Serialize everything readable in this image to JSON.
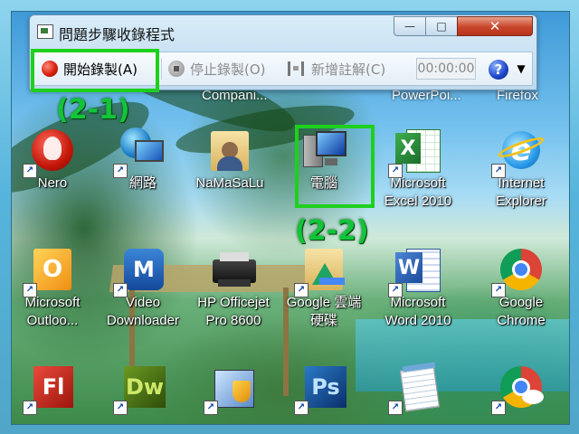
{
  "window": {
    "title": "問題步驟收錄程式",
    "controls": {
      "minimize": "—",
      "maximize": "□",
      "close": "✕"
    }
  },
  "toolbar": {
    "start_record": "開始錄製(A)",
    "stop_record": "停止錄製(O)",
    "add_comment": "新增註解(C)",
    "timer": "00:00:00",
    "help": "?",
    "dropdown": "▼"
  },
  "annotations": {
    "step1": "(2-1)",
    "step2": "(2-2)"
  },
  "desktop": {
    "partial_labels": [
      "Compani...",
      "PowerPoi...",
      "Firefox"
    ],
    "icons": [
      {
        "label": "Nero",
        "icon": "nero-icon"
      },
      {
        "label": "網路",
        "icon": "network-icon"
      },
      {
        "label": "NaMaSaLu",
        "icon": "folder-user-icon"
      },
      {
        "label": "電腦",
        "icon": "computer-icon"
      },
      {
        "label": "Microsoft\nExcel 2010",
        "icon": "excel-icon"
      },
      {
        "label": "Internet\nExplorer",
        "icon": "ie-icon"
      },
      {
        "label": "Microsoft\nOutloo...",
        "icon": "outlook-icon"
      },
      {
        "label": "Video\nDownloader",
        "icon": "video-downloader-icon"
      },
      {
        "label": "HP Officejet\nPro 8600",
        "icon": "printer-icon"
      },
      {
        "label": "Google 雲端\n硬碟",
        "icon": "google-drive-icon"
      },
      {
        "label": "Microsoft\nWord 2010",
        "icon": "word-icon"
      },
      {
        "label": "Google\nChrome",
        "icon": "chrome-icon"
      },
      {
        "label": "",
        "icon": "flash-icon"
      },
      {
        "label": "",
        "icon": "dreamweaver-icon"
      },
      {
        "label": "",
        "icon": "control-panel-icon"
      },
      {
        "label": "",
        "icon": "photoshop-icon"
      },
      {
        "label": "",
        "icon": "notepad-icon"
      },
      {
        "label": "",
        "icon": "chrome-canary-icon"
      }
    ]
  }
}
